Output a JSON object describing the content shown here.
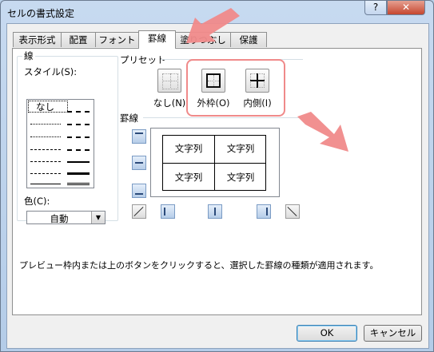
{
  "window": {
    "title": "セルの書式設定",
    "help_label": "?",
    "close_label": "✕"
  },
  "tabs": [
    {
      "label": "表示形式"
    },
    {
      "label": "配置"
    },
    {
      "label": "フォント"
    },
    {
      "label": "罫線",
      "active": true
    },
    {
      "label": "塗りつぶし"
    },
    {
      "label": "保護"
    }
  ],
  "line": {
    "group_title": "線",
    "style_label": "スタイル(S):",
    "none_label": "なし",
    "color_label": "色(C):",
    "color_value": "自動"
  },
  "presets": {
    "group_title": "プリセット",
    "none": "なし(N)",
    "outline": "外枠(O)",
    "inside": "内側(I)"
  },
  "border": {
    "group_title": "罫線",
    "preview_cells": [
      "文字列",
      "文字列",
      "文字列",
      "文字列"
    ]
  },
  "description": "プレビュー枠内または上のボタンをクリックすると、選択した罫線の種類が適用されます。",
  "buttons": {
    "ok": "OK",
    "cancel": "キャンセル"
  },
  "colors": {
    "annotation": "#f08a8a"
  }
}
